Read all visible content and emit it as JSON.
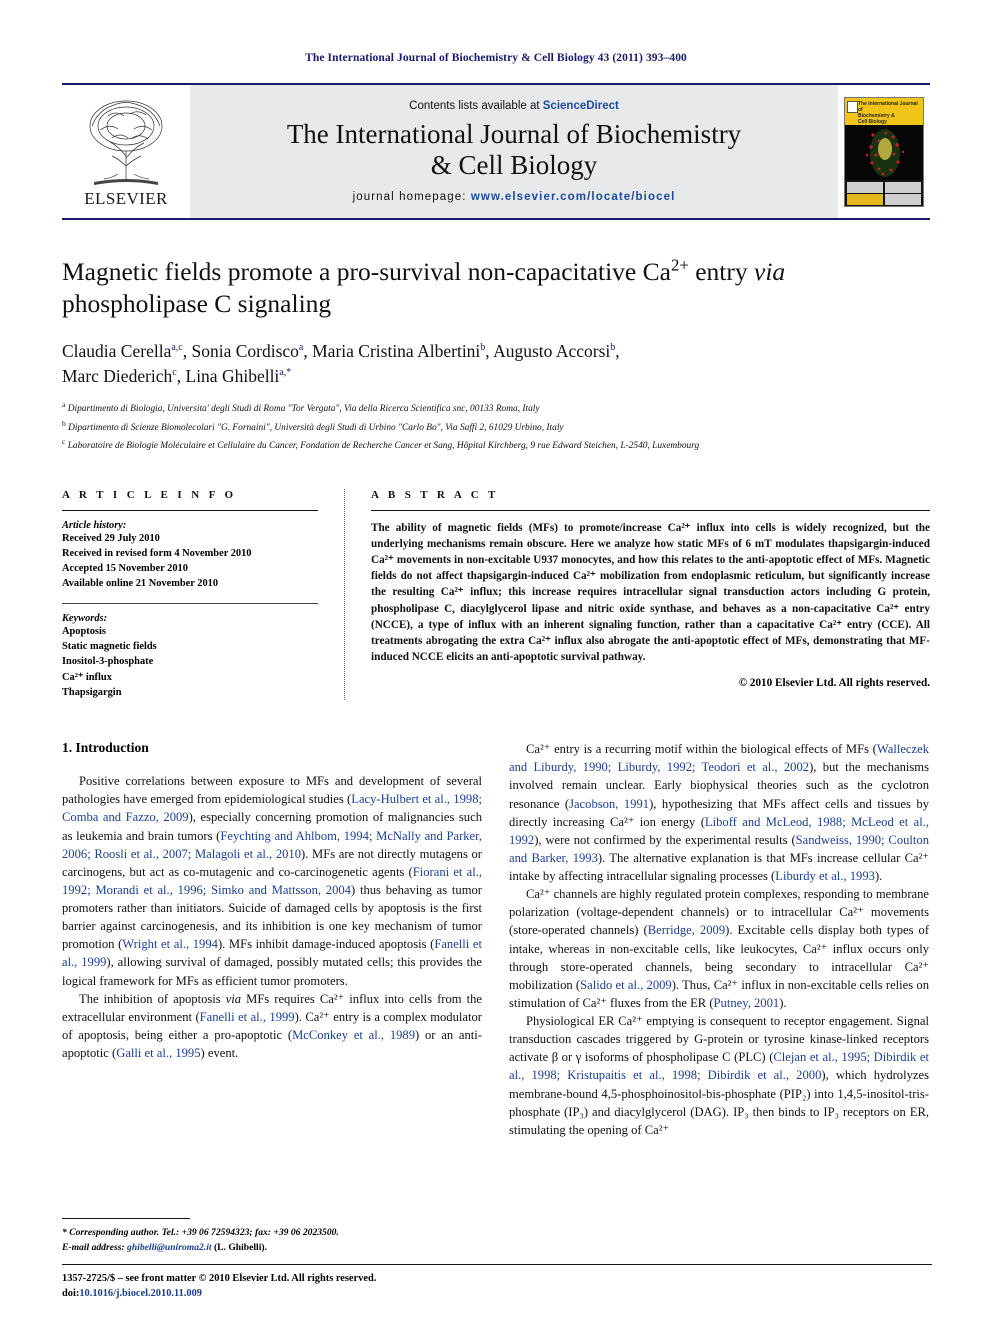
{
  "running_head": "The International Journal of Biochemistry & Cell Biology 43 (2011) 393–400",
  "masthead": {
    "contents_prefix": "Contents lists available at ",
    "sciencedirect": "ScienceDirect",
    "journal_title_line1": "The International Journal of Biochemistry",
    "journal_title_line2": "& Cell Biology",
    "homepage_prefix": "journal homepage:",
    "homepage_url": "www.elsevier.com/locate/biocel",
    "publisher": "ELSEVIER",
    "cover_title_line1": "The International Journal of",
    "cover_title_line2": "Biochemistry &",
    "cover_title_line3": "Cell Biology"
  },
  "article": {
    "title": "Magnetic fields promote a pro-survival non-capacitative Ca²⁺ entry via phospholipase C signaling",
    "title_part1": "Magnetic fields promote a pro-survival non-capacitative Ca",
    "title_sup": "2+",
    "title_part2": " entry ",
    "title_italic": "via",
    "title_part3": " phospholipase C signaling",
    "authors": [
      {
        "name": "Claudia Cerella",
        "sup": "a,c"
      },
      {
        "name": "Sonia Cordisco",
        "sup": "a"
      },
      {
        "name": "Maria Cristina Albertini",
        "sup": "b"
      },
      {
        "name": "Augusto Accorsi",
        "sup": "b"
      },
      {
        "name": "Marc Diederich",
        "sup": "c"
      },
      {
        "name": "Lina Ghibelli",
        "sup": "a,*"
      }
    ],
    "affiliations": [
      {
        "marker": "a",
        "text": "Dipartimento di Biologia, Universita' degli Studi di Roma \"Tor Vergata\", Via della Ricerca Scientifica snc, 00133 Roma, Italy"
      },
      {
        "marker": "b",
        "text": "Dipartimento di Scienze Biomolecolari \"G. Fornaini\", Università degli Studi di Urbino \"Carlo Bo\", Via Saffi 2, 61029 Urbino, Italy"
      },
      {
        "marker": "c",
        "text": "Laboratoire de Biologie Moléculaire et Cellulaire du Cancer, Fondation de Recherche Cancer et Sang, Hôpital Kirchberg, 9 rue Edward Steichen, L-2540, Luxembourg"
      }
    ]
  },
  "article_info": {
    "heading": "A R T I C L E   I N F O",
    "history_label": "Article history:",
    "history": [
      "Received 29 July 2010",
      "Received in revised form 4 November 2010",
      "Accepted 15 November 2010",
      "Available online 21 November 2010"
    ],
    "keywords_label": "Keywords:",
    "keywords": [
      "Apoptosis",
      "Static magnetic fields",
      "Inositol-3-phosphate",
      "Ca²⁺ influx",
      "Thapsigargin"
    ]
  },
  "abstract": {
    "heading": "A B S T R A C T",
    "text": "The ability of magnetic fields (MFs) to promote/increase Ca²⁺ influx into cells is widely recognized, but the underlying mechanisms remain obscure. Here we analyze how static MFs of 6 mT modulates thapsigargin-induced Ca²⁺ movements in non-excitable U937 monocytes, and how this relates to the anti-apoptotic effect of MFs. Magnetic fields do not affect thapsigargin-induced Ca²⁺ mobilization from endoplasmic reticulum, but significantly increase the resulting Ca²⁺ influx; this increase requires intracellular signal transduction actors including G protein, phospholipase C, diacylglycerol lipase and nitric oxide synthase, and behaves as a non-capacitative Ca²⁺ entry (NCCE), a type of influx with an inherent signaling function, rather than a capacitative Ca²⁺ entry (CCE). All treatments abrogating the extra Ca²⁺ influx also abrogate the anti-apoptotic effect of MFs, demonstrating that MF-induced NCCE elicits an anti-apoptotic survival pathway.",
    "copyright": "© 2010 Elsevier Ltd. All rights reserved."
  },
  "introduction": {
    "heading": "1.  Introduction",
    "left_paragraphs": [
      "Positive correlations between exposure to MFs and development of several pathologies have emerged from epidemiological studies (Lacy-Hulbert et al., 1998; Comba and Fazzo, 2009), especially concerning promotion of malignancies such as leukemia and brain tumors (Feychting and Ahlbom, 1994; McNally and Parker, 2006; Roosli et al., 2007; Malagoli et al., 2010). MFs are not directly mutagens or carcinogens, but act as co-mutagenic and co-carcinogenetic agents (Fiorani et al., 1992; Morandi et al., 1996; Simko and Mattsson, 2004) thus behaving as tumor promoters rather than initiators. Suicide of damaged cells by apoptosis is the first barrier against carcinogenesis, and its inhibition is one key mechanism of tumor promotion (Wright et al., 1994). MFs inhibit damage-induced apoptosis (Fanelli et al., 1999), allowing survival of damaged, possibly mutated cells; this provides the logical framework for MFs as efficient tumor promoters.",
      "The inhibition of apoptosis via MFs requires Ca²⁺ influx into cells from the extracellular environment (Fanelli et al., 1999). Ca²⁺ entry is a complex modulator of apoptosis, being either a pro-apoptotic (McConkey et al., 1989) or an anti-apoptotic (Galli et al., 1995) event."
    ],
    "right_paragraphs": [
      "Ca²⁺ entry is a recurring motif within the biological effects of MFs (Walleczek and Liburdy, 1990; Liburdy, 1992; Teodori et al., 2002), but the mechanisms involved remain unclear. Early biophysical theories such as the cyclotron resonance (Jacobson, 1991), hypothesizing that MFs affect cells and tissues by directly increasing Ca²⁺ ion energy (Liboff and McLeod, 1988; McLeod et al., 1992), were not confirmed by the experimental results (Sandweiss, 1990; Coulton and Barker, 1993). The alternative explanation is that MFs increase cellular Ca²⁺ intake by affecting intracellular signaling processes (Liburdy et al., 1993).",
      "Ca²⁺ channels are highly regulated protein complexes, responding to membrane polarization (voltage-dependent channels) or to intracellular Ca²⁺ movements (store-operated channels) (Berridge, 2009). Excitable cells display both types of intake, whereas in non-excitable cells, like leukocytes, Ca²⁺ influx occurs only through store-operated channels, being secondary to intracellular Ca²⁺ mobilization (Salido et al., 2009). Thus, Ca²⁺ influx in non-excitable cells relies on stimulation of Ca²⁺ fluxes from the ER (Putney, 2001).",
      "Physiological ER Ca²⁺ emptying is consequent to receptor engagement. Signal transduction cascades triggered by G-protein or tyrosine kinase-linked receptors activate β or γ isoforms of phospholipase C (PLC) (Clejan et al., 1995; Dibirdik et al., 1998; Kristupaitis et al., 1998; Dibirdik et al., 2000), which hydrolyzes membrane-bound 4,5-phosphoinositol-bis-phosphate (PIP₂) into 1,4,5-inositol-tris-phosphate (IP₃) and diacylglycerol (DAG). IP₃ then binds to IP₃ receptors on ER, stimulating the opening of Ca²⁺"
    ]
  },
  "footnote": {
    "corresponding": "* Corresponding author. Tel.: +39 06 72594323; fax: +39 06 2023500.",
    "email_label": "E-mail address:",
    "email": "ghibelli@uniroma2.it",
    "email_suffix": "(L. Ghibelli)."
  },
  "footer": {
    "issn_line": "1357-2725/$ – see front matter © 2010 Elsevier Ltd. All rights reserved.",
    "doi_prefix": "doi:",
    "doi": "10.1016/j.biocel.2010.11.009"
  },
  "colors": {
    "accent_blue": "#1a1a6e",
    "citation_blue": "#1c3f94",
    "link_blue": "#1c4b9c",
    "masthead_grey": "#e8e9ea",
    "cover_yellow": "#f0c419"
  }
}
